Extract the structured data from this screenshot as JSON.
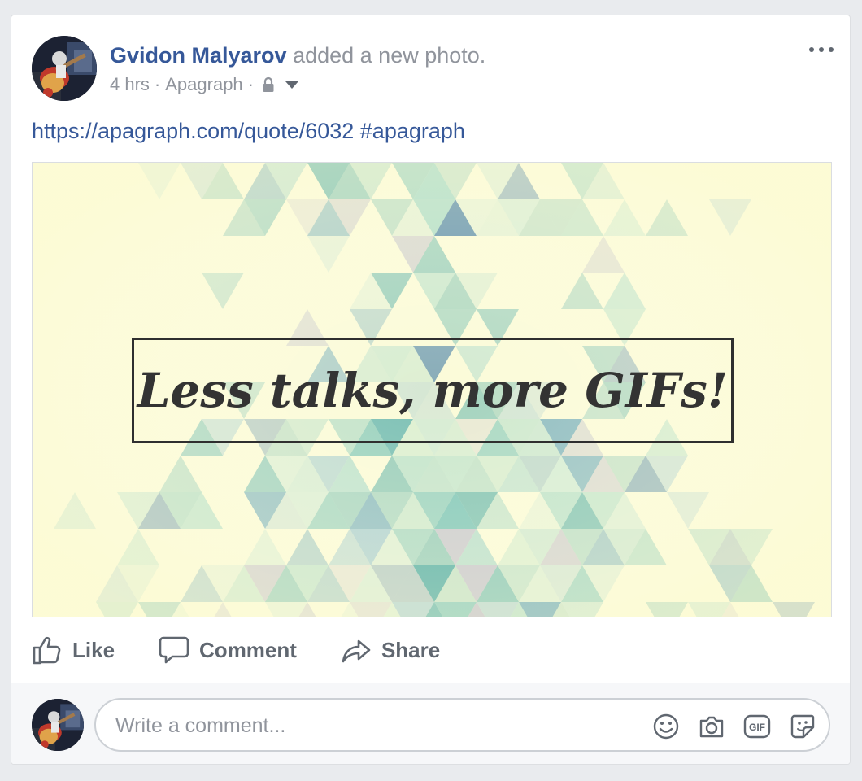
{
  "post": {
    "author": "Gvidon Malyarov",
    "action": "added a new photo.",
    "time": "4 hrs",
    "separator": "·",
    "source": "Apagraph",
    "privacy_icon": "lock-icon",
    "audience_menu_icon": "caret-down-icon",
    "options_icon": "more-horizontal-icon",
    "link_text": "https://apagraph.com/quote/6032 #apagraph"
  },
  "photo": {
    "quote": "Less talks, more GIFs!",
    "colors": {
      "background": "#fbfbd8",
      "accent_teal": "#46a7a1",
      "accent_blue": "#2f6e9e",
      "border": "#2f2f2f"
    }
  },
  "actions": {
    "like": {
      "label": "Like",
      "icon": "thumbs-up-icon"
    },
    "comment": {
      "label": "Comment",
      "icon": "speech-bubble-icon"
    },
    "share": {
      "label": "Share",
      "icon": "share-arrow-icon"
    }
  },
  "comment_box": {
    "placeholder": "Write a comment...",
    "icons": [
      "emoji-icon",
      "camera-icon",
      "gif-icon",
      "sticker-icon"
    ]
  },
  "colors": {
    "link": "#365899",
    "secondary_text": "#90949c",
    "action_text": "#606770",
    "page_background": "#e9ebee"
  }
}
